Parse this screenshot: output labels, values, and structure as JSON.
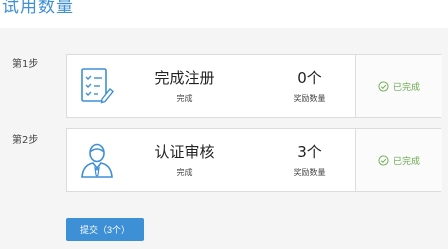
{
  "page": {
    "title": "试用数量"
  },
  "steps": [
    {
      "step_label": "第1步",
      "icon": "checklist-edit-icon",
      "task_name": "完成注册",
      "task_status": "完成",
      "reward_count": "0个",
      "reward_label": "奖励数量",
      "done_text": "已完成"
    },
    {
      "step_label": "第2步",
      "icon": "user-verify-icon",
      "task_name": "认证审核",
      "task_status": "完成",
      "reward_count": "3个",
      "reward_label": "奖励数量",
      "done_text": "已完成"
    }
  ],
  "submit": {
    "label": "提交（3个）"
  },
  "colors": {
    "accent": "#3d8fd6",
    "done": "#6aa84f"
  }
}
